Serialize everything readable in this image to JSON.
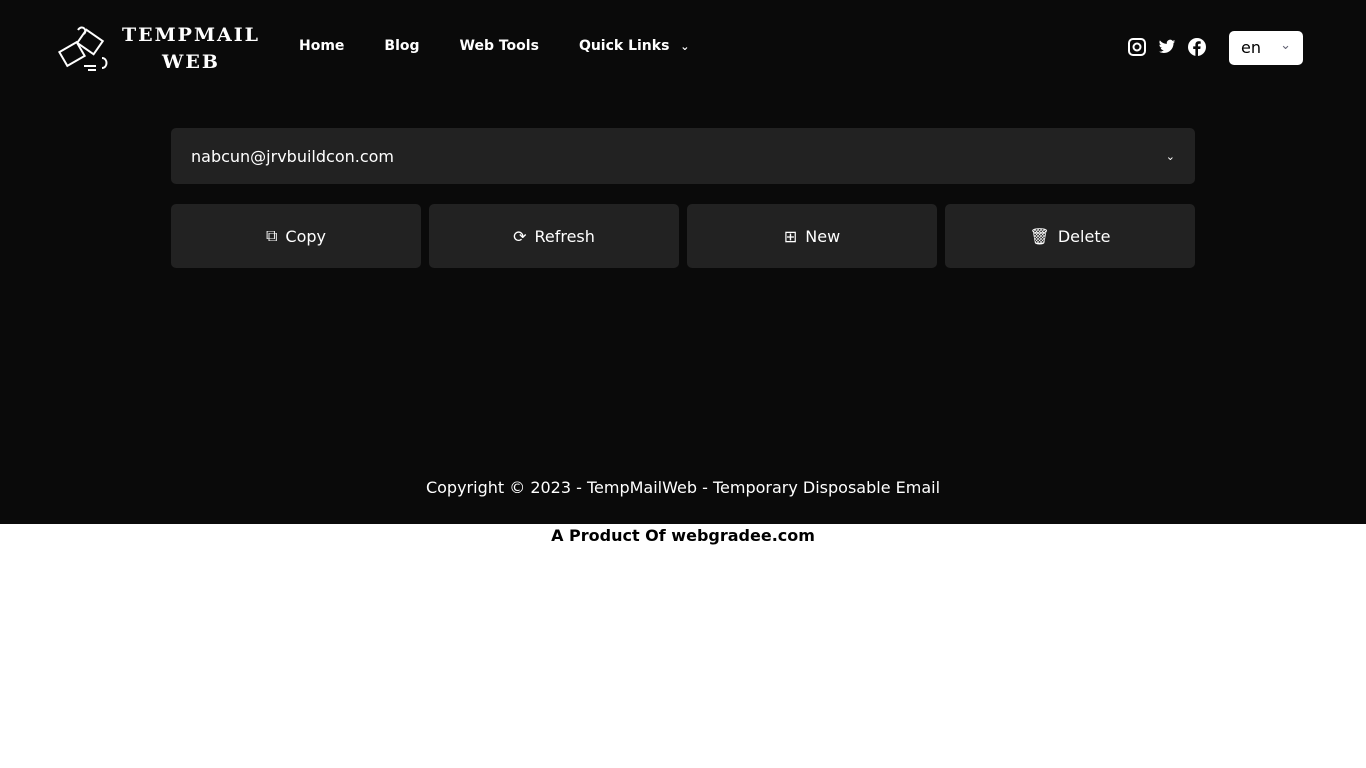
{
  "logo": {
    "line1": "TEMPMAIL",
    "line2": "WEB"
  },
  "nav": {
    "home": "Home",
    "blog": "Blog",
    "web_tools": "Web Tools",
    "quick_links": "Quick Links"
  },
  "lang": {
    "value": "en"
  },
  "email": {
    "value": "nabcun@jrvbuildcon.com"
  },
  "actions": {
    "copy": "Copy",
    "refresh": "Refresh",
    "new": "New",
    "delete": "Delete"
  },
  "footer": {
    "copyright": "Copyright © 2023 - TempMailWeb - Temporary Disposable Email",
    "product": "A Product Of webgradee.com"
  }
}
